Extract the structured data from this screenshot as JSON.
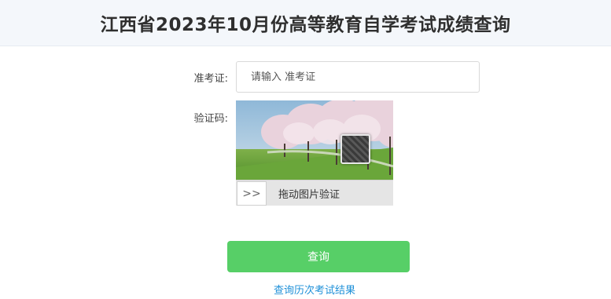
{
  "header": {
    "title": "江西省2023年10月份高等教育自学考试成绩查询"
  },
  "form": {
    "ticket_label": "准考证:",
    "ticket_placeholder": "请输入 准考证",
    "captcha_label": "验证码:"
  },
  "captcha": {
    "handle_icon": "double-chevron-right-icon",
    "handle_glyph": ">>",
    "slider_text": "拖动图片验证"
  },
  "actions": {
    "query_label": "查询",
    "history_link": "查询历次考试结果"
  },
  "colors": {
    "header_bg": "#f4f7fb",
    "query_button": "#57cf67",
    "link": "#1e90d8"
  }
}
